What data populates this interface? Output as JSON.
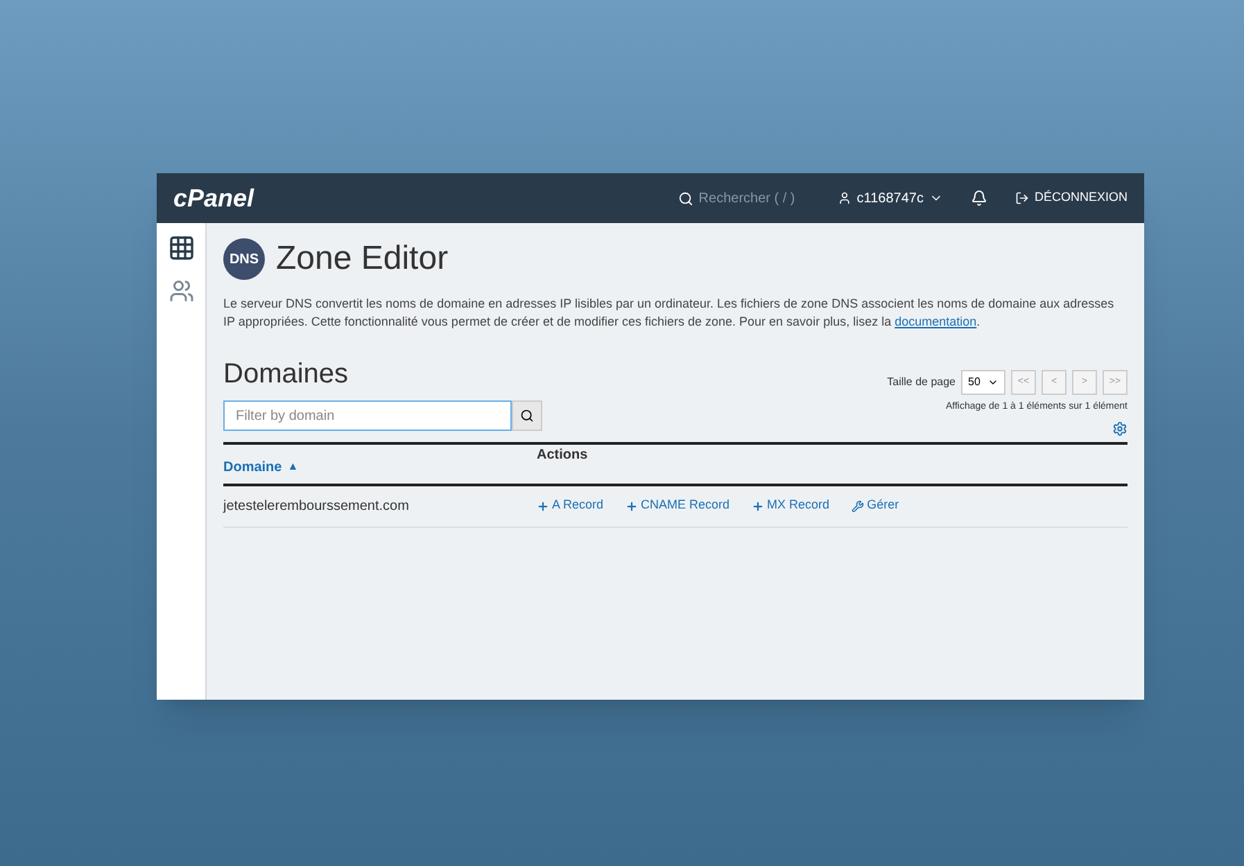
{
  "header": {
    "logo": "cPanel",
    "search": {
      "placeholder": "Rechercher ( / )"
    },
    "user": "c1168747c",
    "logout": "DÉCONNEXION"
  },
  "sidebar": {
    "items": [
      {
        "kind": "grid",
        "selected": true
      },
      {
        "kind": "users",
        "selected": false
      }
    ]
  },
  "page": {
    "icon_label": "DNS",
    "title": "Zone Editor",
    "description": "Le serveur DNS convertit les noms de domaine en adresses IP lisibles par un ordinateur. Les fichiers de zone DNS associent les noms de domaine aux adresses IP appropriées. Cette fonctionnalité vous permet de créer et de modifier ces fichiers de zone. Pour en savoir plus, lisez la",
    "link": "documentation",
    "link_tail": "."
  },
  "domains": {
    "heading": "Domaines",
    "filter": {
      "placeholder": "Filter by domain"
    },
    "page_size_label": "Taille de page",
    "page_size": "50",
    "pager": [
      "<<",
      "<",
      ">",
      ">>"
    ],
    "summary": "Affichage de 1 à 1 éléments sur 1 élément",
    "columns": [
      {
        "label": "Domaine",
        "sort": "▲"
      },
      {
        "label": "Actions"
      }
    ],
    "rows": [
      {
        "domain": "jetestelerembourssement.com",
        "actions": [
          {
            "kind": "add",
            "label": "A Record"
          },
          {
            "kind": "add",
            "label": "CNAME Record"
          },
          {
            "kind": "add",
            "label": "MX Record"
          },
          {
            "kind": "manage",
            "label": "Gérer"
          }
        ]
      }
    ]
  }
}
